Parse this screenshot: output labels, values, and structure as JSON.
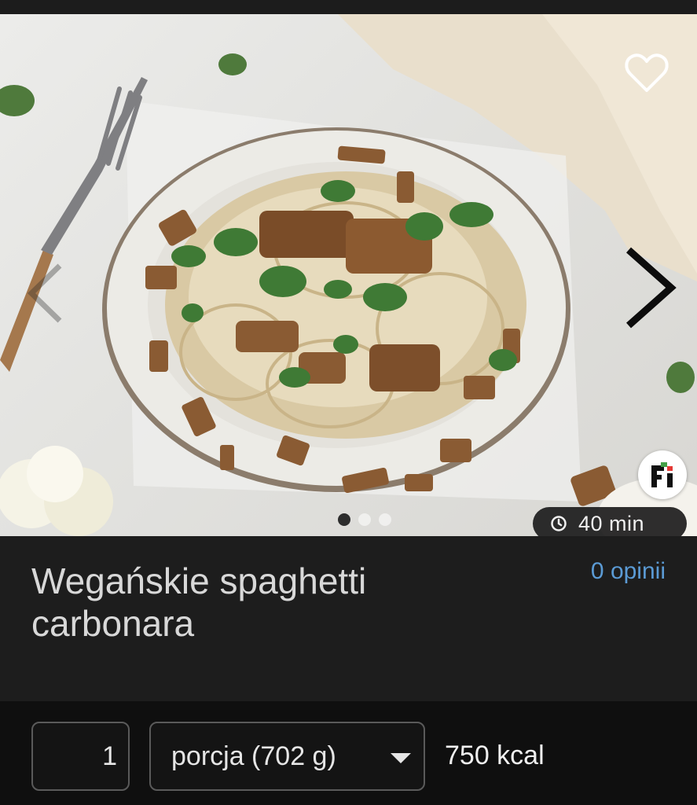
{
  "recipe": {
    "title": "Wegańskie spaghetti carbonara",
    "reviews_link": "0 opinii",
    "time": "40 min"
  },
  "gallery": {
    "dot_count": 3,
    "active_index": 0
  },
  "controls": {
    "quantity": "1",
    "portion": "porcja (702 g)",
    "calories": "750 kcal"
  },
  "icons": {
    "favorite": "heart-outline-icon",
    "prev": "chevron-left-icon",
    "next": "chevron-right-icon",
    "time": "clock-icon",
    "brand": "fitatu-logo-icon",
    "dropdown": "caret-down-icon"
  },
  "colors": {
    "link": "#5b9bd5",
    "panel": "#1d1d1d",
    "controls_bg": "#0f0f0f"
  }
}
